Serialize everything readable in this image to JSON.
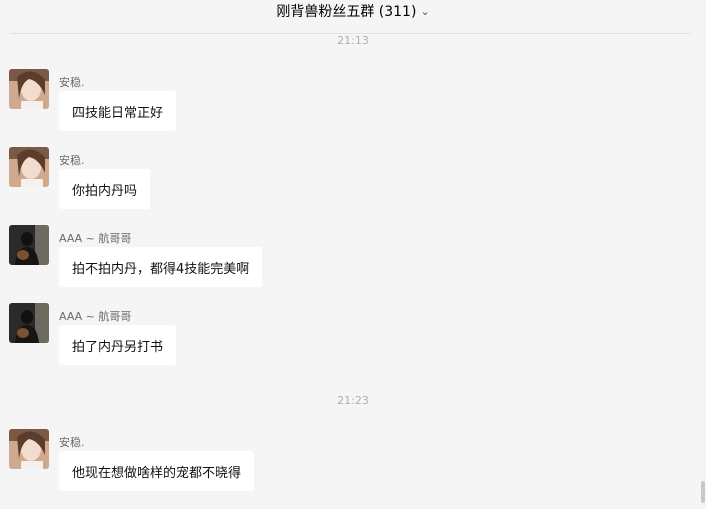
{
  "header": {
    "title": "刚背兽粉丝五群 (311)",
    "chevron_icon": "chevron-down-icon"
  },
  "timestamps": [
    "21:13",
    "21:23"
  ],
  "messages": [
    {
      "sender": "安稳.",
      "text": "四技能日常正好",
      "avatar": "avatar-girl"
    },
    {
      "sender": "安稳.",
      "text": "你拍内丹吗",
      "avatar": "avatar-girl"
    },
    {
      "sender": "AAA ~ 航哥哥",
      "text": "拍不拍内丹，都得4技能完美啊",
      "avatar": "avatar-dark"
    },
    {
      "sender": "AAA ~ 航哥哥",
      "text": "拍了内丹另打书",
      "avatar": "avatar-dark"
    },
    {
      "sender": "安稳.",
      "text": "他现在想做啥样的宠都不晓得",
      "avatar": "avatar-girl"
    }
  ]
}
